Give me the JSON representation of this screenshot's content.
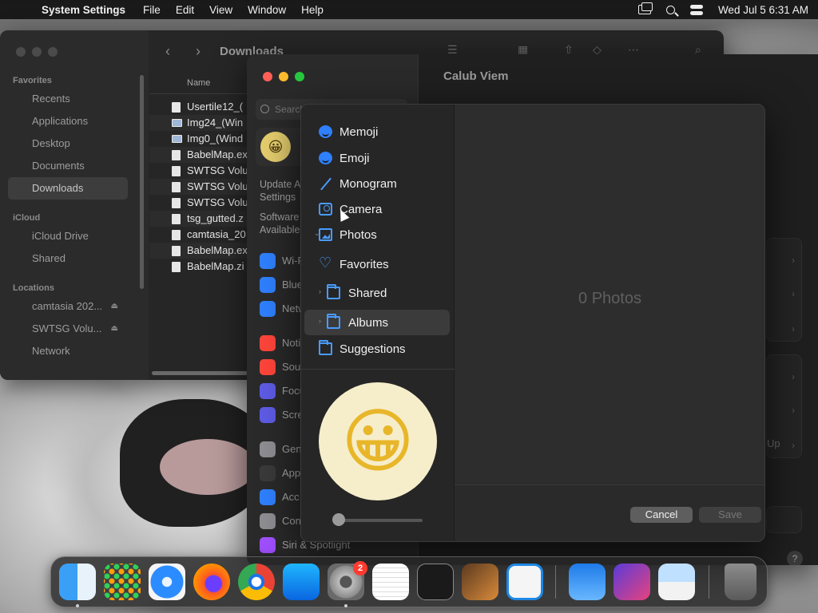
{
  "menubar": {
    "apple": "",
    "app_name": "System Settings",
    "menus": [
      "File",
      "Edit",
      "View",
      "Window",
      "Help"
    ],
    "clock": "Wed Jul 5  6:31 AM"
  },
  "finder": {
    "title": "Downloads",
    "sidebar": {
      "favorites_heading": "Favorites",
      "favorites": [
        "Recents",
        "Applications",
        "Desktop",
        "Documents",
        "Downloads"
      ],
      "icloud_heading": "iCloud",
      "icloud": [
        "iCloud Drive",
        "Shared"
      ],
      "locations_heading": "Locations",
      "locations": [
        "camtasia 202...",
        "SWTSG Volu...",
        "Network"
      ]
    },
    "column_name": "Name",
    "files": [
      "Usertile12_(",
      "Img24_(Win",
      "Img0_(Wind",
      "BabelMap.ex",
      "SWTSG Volu",
      "SWTSG Volu",
      "SWTSG Volu",
      "tsg_gutted.z",
      "camtasia_20",
      "BabelMap.ex",
      "BabelMap.zi"
    ]
  },
  "settings": {
    "title": "Calub Viem",
    "search_placeholder": "Search",
    "update_text": "Update A\nSettings",
    "software_text": "Software\nAvailable",
    "items": [
      {
        "label": "Wi-Fi",
        "color": "#2f80ff"
      },
      {
        "label": "Blue",
        "color": "#2f80ff"
      },
      {
        "label": "Netw",
        "color": "#2f80ff"
      },
      {
        "label": "Noti",
        "color": "#ff453a"
      },
      {
        "label": "Sou",
        "color": "#ff453a"
      },
      {
        "label": "Focu",
        "color": "#5e5ce6"
      },
      {
        "label": "Scre",
        "color": "#5e5ce6"
      },
      {
        "label": "Gen",
        "color": "#8e8e93"
      },
      {
        "label": "App",
        "color": "#3a3a3a"
      },
      {
        "label": "Acc",
        "color": "#2f80ff"
      },
      {
        "label": "Con",
        "color": "#8e8e93"
      },
      {
        "label": "Siri & Spotlight",
        "color": "#a050ff"
      }
    ],
    "up_label": "Up",
    "help": "?"
  },
  "picker": {
    "nav": [
      {
        "label": "Memoji",
        "icon": "face-icon"
      },
      {
        "label": "Emoji",
        "icon": "face-icon"
      },
      {
        "label": "Monogram",
        "icon": "pen-icon"
      },
      {
        "label": "Camera",
        "icon": "camera-icon"
      },
      {
        "label": "Photos",
        "icon": "photos-icon"
      },
      {
        "label": "Favorites",
        "icon": "heart-icon"
      },
      {
        "label": "Shared",
        "icon": "folder-icon"
      },
      {
        "label": "Albums",
        "icon": "folder-icon"
      },
      {
        "label": "Suggestions",
        "icon": "folder-icon"
      }
    ],
    "selected": "Albums",
    "preview_emoji": "😀",
    "empty_text": "0 Photos",
    "cancel": "Cancel",
    "save": "Save",
    "accent": "#4a9bff"
  },
  "dock": {
    "apps": [
      "Finder",
      "Launchpad",
      "Safari",
      "Firefox",
      "Chrome",
      "App Store",
      "System Settings",
      "TextEdit",
      "Terminal",
      "GarageBand",
      "Visual Studio Code",
      "Weather",
      "Shortcuts",
      "Preview",
      "Trash"
    ],
    "settings_badge": "2"
  }
}
